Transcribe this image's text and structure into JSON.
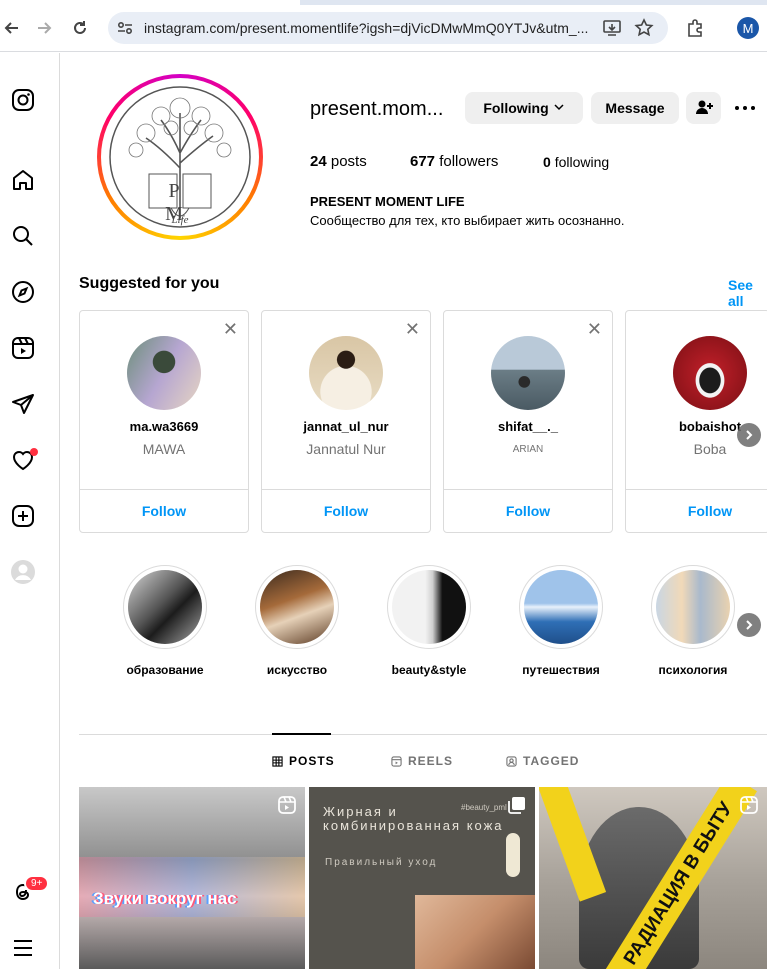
{
  "browser": {
    "url": "instagram.com/present.momentlife?igsh=djVicDMwMmQ0YTJv&utm_...",
    "profile_initial": "M"
  },
  "sidebar": {
    "icons": [
      "instagram-icon",
      "home-icon",
      "search-icon",
      "explore-icon",
      "reels-icon",
      "messages-icon",
      "notifications-icon",
      "create-icon",
      "profile-icon",
      "threads-icon",
      "menu-icon"
    ],
    "threads_badge": "9+"
  },
  "profile": {
    "username": "present.mom...",
    "following_button": "Following",
    "message_button": "Message",
    "posts_count": "24",
    "posts_label": "posts",
    "followers_count": "677",
    "followers_label": "followers",
    "following_count": "0",
    "following_label": "following",
    "bio_name": "PRESENT MOMENT LIFE",
    "bio_text": "Сообщество для тех, кто выбирает жить осознанно.",
    "logo_letters": "P M",
    "logo_script": "Life"
  },
  "suggested": {
    "title": "Suggested for you",
    "see_all": "See all",
    "follow_label": "Follow",
    "cards": [
      {
        "username": "ma.wa3669",
        "subtitle": "MAWA"
      },
      {
        "username": "jannat_ul_nur",
        "subtitle": "Jannatul Nur"
      },
      {
        "username": "shifat__._",
        "subtitle": "ARIAN"
      },
      {
        "username": "bobaishot",
        "subtitle": "Boba"
      }
    ]
  },
  "highlights": [
    {
      "label": "образование"
    },
    {
      "label": "искусство"
    },
    {
      "label": "beauty&style"
    },
    {
      "label": "путешествия"
    },
    {
      "label": "психология"
    }
  ],
  "tabs": [
    {
      "label": "POSTS",
      "active": true
    },
    {
      "label": "REELS",
      "active": false
    },
    {
      "label": "TAGGED",
      "active": false
    }
  ],
  "posts": [
    {
      "overlay_text": "Звуки вокруг нас"
    },
    {
      "overlay_text": "Жирная и комбинированная кожа",
      "sub_text": "Правильный уход",
      "tag": "#beauty_pml"
    },
    {
      "overlay_text": "РАДИАЦИЯ В БЫТУ"
    }
  ],
  "colors": {
    "accent_blue": "#0095f6",
    "badge_red": "#ff3040",
    "button_grey": "#efefef",
    "border": "#dbdbdb"
  }
}
